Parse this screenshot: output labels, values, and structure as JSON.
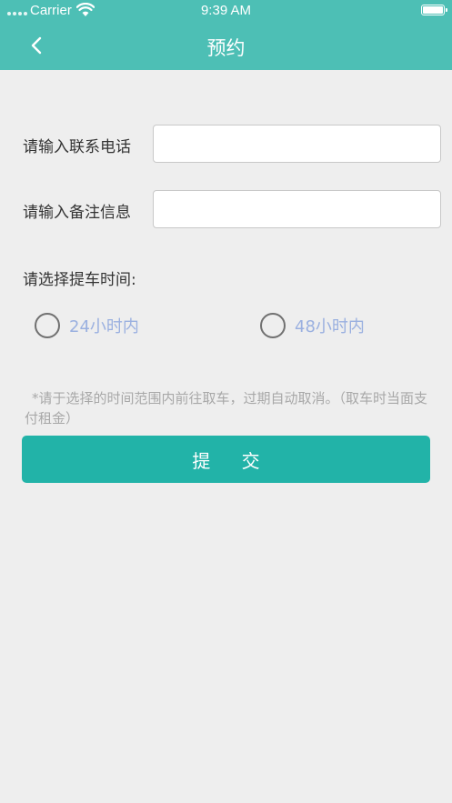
{
  "status_bar": {
    "carrier": "Carrier",
    "time": "9:39 AM"
  },
  "nav": {
    "title": "预约",
    "back_icon": "chevron-left-icon"
  },
  "form": {
    "phone_label": "请输入联系电话",
    "phone_value": "",
    "note_label": "请输入备注信息",
    "note_value": ""
  },
  "pickup": {
    "label": "请选择提车时间:",
    "options": [
      {
        "label": "24小时内",
        "selected": false
      },
      {
        "label": "48小时内",
        "selected": false
      }
    ]
  },
  "notice": "*请于选择的时间范围内前往取车，过期自动取消。（取车时当面支付租金）",
  "submit_label": "提 交",
  "colors": {
    "header": "#4dbfb5",
    "button": "#22b3a8",
    "background": "#eeeeee",
    "option_text": "#9ab0e0"
  }
}
